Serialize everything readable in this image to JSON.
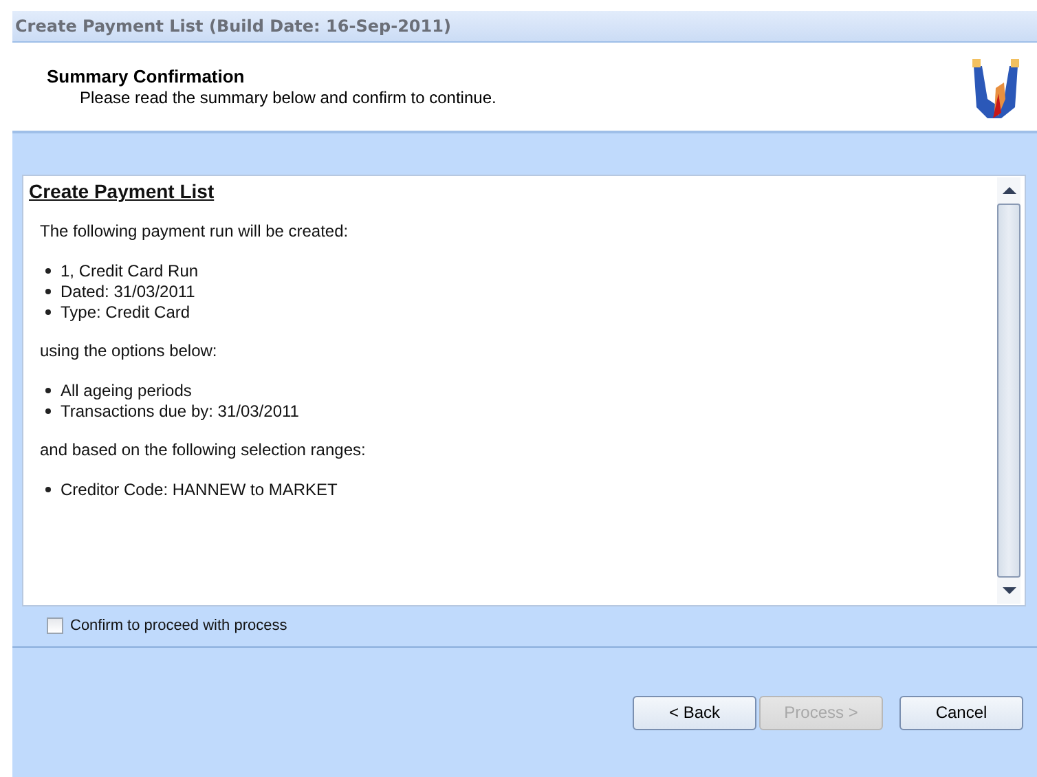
{
  "window": {
    "title": "Create Payment List (Build Date: 16-Sep-2011)"
  },
  "header": {
    "title": "Summary Confirmation",
    "subtitle": "Please read the summary below and confirm to continue."
  },
  "summary": {
    "heading": "Create Payment List",
    "blocks": [
      {
        "kind": "text",
        "text": "The following payment run will be created:"
      },
      {
        "kind": "list",
        "items": [
          "1, Credit Card Run",
          "Dated: 31/03/2011",
          "Type: Credit Card"
        ]
      },
      {
        "kind": "text",
        "text": "using the options below:"
      },
      {
        "kind": "list",
        "items": [
          "All ageing periods",
          "Transactions due by: 31/03/2011"
        ]
      },
      {
        "kind": "text",
        "text": "and based on the following selection ranges:"
      },
      {
        "kind": "list",
        "items": [
          "Creditor Code: HANNEW to MARKET"
        ]
      }
    ]
  },
  "confirm": {
    "label": "Confirm to proceed with process",
    "checked": false
  },
  "buttons": [
    {
      "label": "< Back",
      "disabled": false
    },
    {
      "label": "Process >",
      "disabled": true
    },
    {
      "label": "Cancel",
      "disabled": false
    }
  ]
}
